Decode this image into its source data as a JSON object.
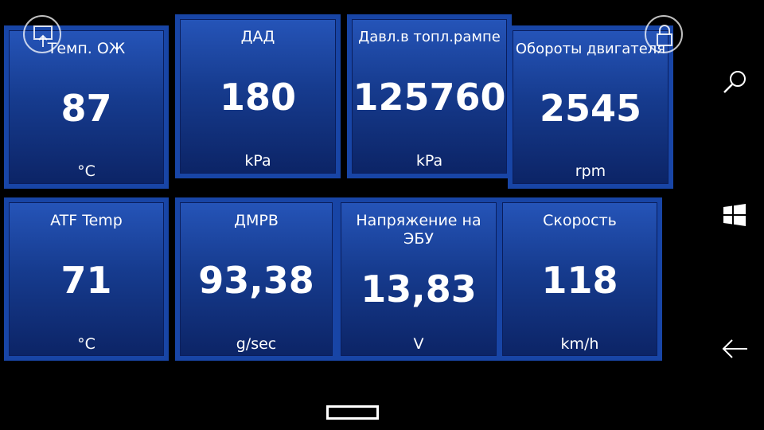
{
  "gauges": [
    {
      "title": "Темп. ОЖ",
      "value": "87",
      "unit": "°C"
    },
    {
      "title": "ДАД",
      "value": "180",
      "unit": "kPa"
    },
    {
      "title": "Давл.в топл.рампе",
      "value": "125760",
      "unit": "kPa"
    },
    {
      "title": "Обороты двигателя",
      "value": "2545",
      "unit": "rpm"
    },
    {
      "title": "ATF Temp",
      "value": "71",
      "unit": "°C"
    },
    {
      "title": "ДМРВ",
      "value": "93,38",
      "unit": "g/sec"
    },
    {
      "title": "Напряжение на ЭБУ",
      "value": "13,83",
      "unit": "V"
    },
    {
      "title": "Скорость",
      "value": "118",
      "unit": "km/h"
    }
  ],
  "icons": {
    "top_left": "screen-upload-icon",
    "top_right": "lock-icon",
    "nav_search": "search-icon",
    "nav_start": "windows-icon",
    "nav_back": "back-arrow-icon",
    "home": "home-bar-icon"
  }
}
